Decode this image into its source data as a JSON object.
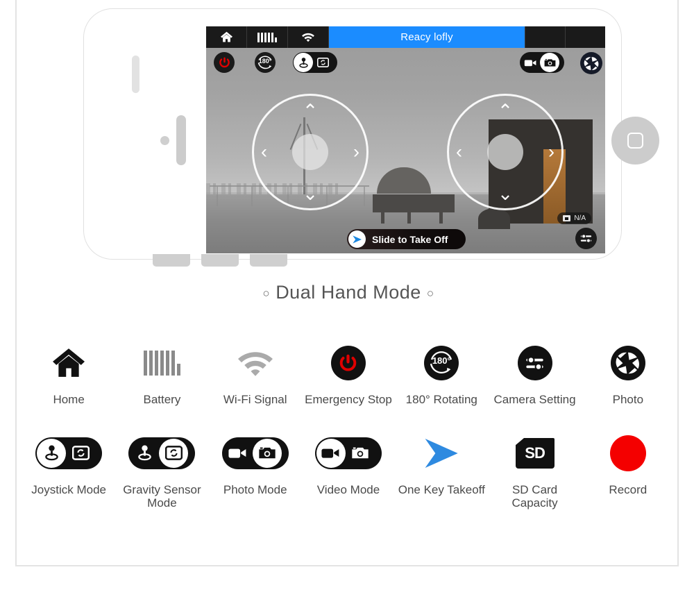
{
  "phone_screen": {
    "status_bar": {
      "home_icon": "home-icon",
      "battery_icon": "battery-icon",
      "wifi_icon": "wifi-icon",
      "title": "Reacy lofly",
      "empty_cells": 2
    },
    "top_controls": {
      "power_icon": "emergency-stop-icon",
      "rotate_label": "180°",
      "rotate_icon": "180-rotating-icon",
      "control_mode_toggle": {
        "left_icon": "joystick-mode-icon",
        "right_icon": "gravity-sensor-mode-icon",
        "selected": "left"
      },
      "capture_mode_toggle": {
        "left_icon": "video-mode-icon",
        "right_icon": "photo-mode-icon",
        "selected": "right"
      },
      "shutter_icon": "photo-shutter-icon"
    },
    "joysticks": [
      {
        "name": "left-joystick",
        "up": "⌃",
        "down": "⌄",
        "left": "‹",
        "right": "›"
      },
      {
        "name": "right-joystick",
        "up": "⌃",
        "down": "⌄",
        "left": "‹",
        "right": "›"
      }
    ],
    "sd_badge": {
      "icon": "sd-card-icon",
      "text": "N/A"
    },
    "takeoff_button": {
      "label": "Slide to Take Off",
      "knob_icon": "one-key-takeoff-icon"
    },
    "camera_setting_button": {
      "icon": "camera-setting-icon"
    }
  },
  "caption": {
    "left_marker": "○",
    "text": "Dual Hand Mode",
    "right_marker": "○"
  },
  "legend": {
    "rows": [
      [
        {
          "label": "Home",
          "icon": "home-icon"
        },
        {
          "label": "Battery",
          "icon": "battery-icon"
        },
        {
          "label": "Wi-Fi Signal",
          "icon": "wifi-icon"
        },
        {
          "label": "Emergency Stop",
          "icon": "emergency-stop-icon"
        },
        {
          "label": "180° Rotating",
          "icon": "180-rotating-icon",
          "badge": "180°"
        },
        {
          "label": "Camera Setting",
          "icon": "camera-setting-icon"
        },
        {
          "label": "Photo",
          "icon": "photo-shutter-icon"
        }
      ],
      [
        {
          "label": "Joystick Mode",
          "icon": "joystick-mode-toggle-icon",
          "selected": "left"
        },
        {
          "label": "Gravity Sensor Mode",
          "icon": "gravity-sensor-mode-toggle-icon",
          "selected": "right"
        },
        {
          "label": "Photo Mode",
          "icon": "photo-mode-toggle-icon",
          "selected": "right"
        },
        {
          "label": "Video Mode",
          "icon": "video-mode-toggle-icon",
          "selected": "left"
        },
        {
          "label": "One Key Takeoff",
          "icon": "one-key-takeoff-icon"
        },
        {
          "label": "SD Card Capacity",
          "icon": "sd-card-icon",
          "badge": "SD"
        },
        {
          "label": "Record",
          "icon": "record-icon"
        }
      ]
    ]
  },
  "colors": {
    "accent_blue": "#1b8cff",
    "takeoff_arrow_blue": "#1b87e0",
    "emergency_red": "#e00000",
    "record_red": "#f40000",
    "icon_black": "#111111",
    "label_gray": "#4a4a4a",
    "panel_border": "#e3e3e3"
  }
}
